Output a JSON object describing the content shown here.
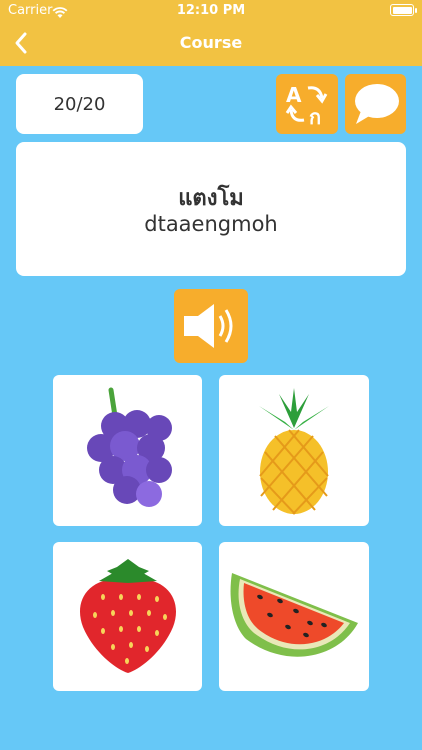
{
  "status_bar": {
    "carrier": "Carrier",
    "time": "12:10 PM"
  },
  "nav": {
    "title": "Course",
    "back_icon": "chevron-left-icon"
  },
  "progress": {
    "label": "20/20"
  },
  "actions": {
    "translate_icon": "translate-icon",
    "chat_icon": "speech-bubble-icon"
  },
  "word": {
    "native": "แตงโม",
    "romanized": "dtaaengmoh"
  },
  "audio": {
    "icon": "speaker-icon"
  },
  "choices": [
    {
      "icon": "grapes-icon"
    },
    {
      "icon": "pineapple-icon"
    },
    {
      "icon": "strawberry-icon"
    },
    {
      "icon": "watermelon-icon"
    }
  ],
  "colors": {
    "background": "#66c8f7",
    "header": "#f2c242",
    "button": "#f7ad2c",
    "card": "#ffffff"
  }
}
